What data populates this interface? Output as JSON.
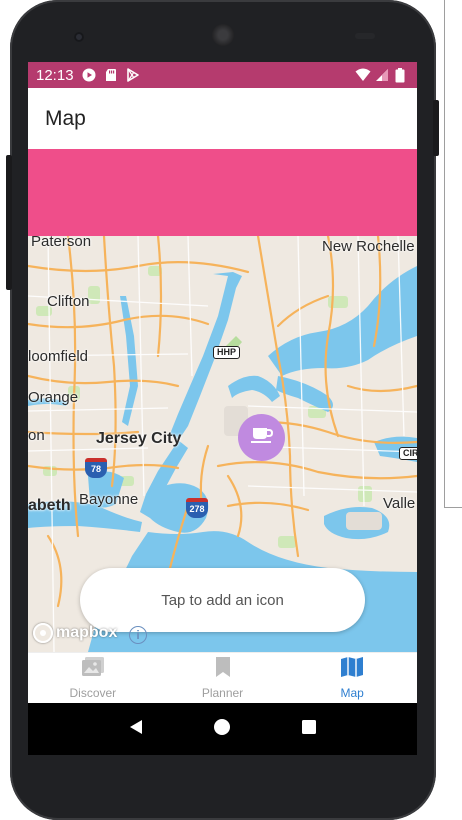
{
  "status_bar": {
    "time": "12:13",
    "background": "#b53b6e"
  },
  "app_bar": {
    "title": "Map"
  },
  "banner": {
    "color": "#ef4e8a"
  },
  "map": {
    "labels": {
      "paterson": "Paterson",
      "new_rochelle": "New Rochelle",
      "clifton": "Clifton",
      "bloomfield": "loomfield",
      "orange": "Orange",
      "on": "on",
      "jersey_city": "Jersey City",
      "bayonne": "Bayonne",
      "elizabeth": "abeth",
      "valley": "Valle"
    },
    "shields": {
      "hhp": "HHP",
      "i78": "78",
      "i278": "278",
      "cir": "CIR"
    },
    "marker_icon": "coffee-cup-icon",
    "marker_color": "#c08ae0"
  },
  "toast": {
    "text": "Tap to add an icon"
  },
  "attribution": {
    "logo_text": "mapbox",
    "info_label": "i"
  },
  "bottom_nav": {
    "items": [
      {
        "label": "Discover",
        "icon": "photo-icon",
        "active": false
      },
      {
        "label": "Planner",
        "icon": "bookmark-icon",
        "active": false
      },
      {
        "label": "Map",
        "icon": "map-icon",
        "active": true
      }
    ],
    "active_color": "#2f7fd0",
    "inactive_color": "#9e9e9e"
  },
  "system_nav": {
    "back_icon": "back-triangle-icon",
    "home_icon": "home-circle-icon",
    "recents_icon": "recents-square-icon"
  }
}
